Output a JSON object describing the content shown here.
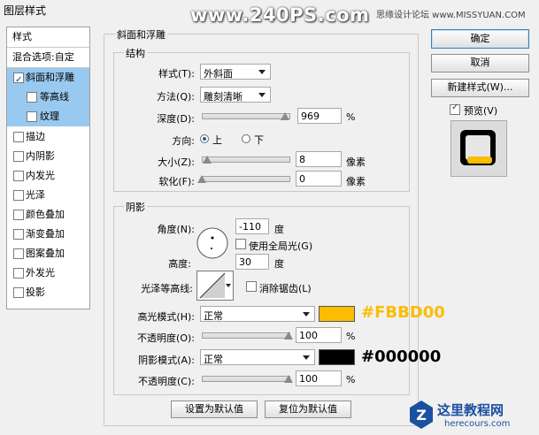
{
  "window": {
    "title": "图层样式"
  },
  "watermark": {
    "site": "www.240PS.com",
    "forum": "思缘设计论坛 www.MISSYUAN.COM",
    "logo": "这里教程网",
    "logo_url": "herecours.com"
  },
  "styles_panel": {
    "header": "样式",
    "blend": "混合选项:自定",
    "items": [
      {
        "label": "斜面和浮雕",
        "checked": true
      },
      {
        "label": "等高线",
        "checked": false
      },
      {
        "label": "纹理",
        "checked": false
      },
      {
        "label": "描边",
        "checked": false
      },
      {
        "label": "内阴影",
        "checked": false
      },
      {
        "label": "内发光",
        "checked": false
      },
      {
        "label": "光泽",
        "checked": false
      },
      {
        "label": "颜色叠加",
        "checked": false
      },
      {
        "label": "渐变叠加",
        "checked": false
      },
      {
        "label": "图案叠加",
        "checked": false
      },
      {
        "label": "外发光",
        "checked": false
      },
      {
        "label": "投影",
        "checked": false
      }
    ]
  },
  "bevel": {
    "title": "斜面和浮雕",
    "structure": {
      "title": "结构",
      "style_label": "样式(T):",
      "style_value": "外斜面",
      "technique_label": "方法(Q):",
      "technique_value": "雕刻清晰",
      "depth_label": "深度(D):",
      "depth_value": "969",
      "depth_unit": "%",
      "direction_label": "方向:",
      "dir_up": "上",
      "dir_down": "下",
      "size_label": "大小(Z):",
      "size_value": "8",
      "size_unit": "像素",
      "soften_label": "软化(F):",
      "soften_value": "0",
      "soften_unit": "像素"
    },
    "shading": {
      "title": "阴影",
      "angle_label": "角度(N):",
      "angle_value": "-110",
      "angle_unit": "度",
      "global_light": "使用全局光(G)",
      "altitude_label": "高度:",
      "altitude_value": "30",
      "altitude_unit": "度",
      "gloss_label": "光泽等高线:",
      "anti_alias": "消除锯齿(L)",
      "highlight_mode_label": "高光模式(H):",
      "highlight_mode": "正常",
      "highlight_color": "#FBBD00",
      "highlight_color_text": "#FBBD00",
      "hl_opacity_label": "不透明度(O):",
      "hl_opacity_value": "100",
      "hl_opacity_unit": "%",
      "shadow_mode_label": "阴影模式(A):",
      "shadow_mode": "正常",
      "shadow_color": "#000000",
      "shadow_color_text": "#000000",
      "sh_opacity_label": "不透明度(C):",
      "sh_opacity_value": "100",
      "sh_opacity_unit": "%"
    },
    "make_default": "设置为默认值",
    "reset_default": "复位为默认值"
  },
  "right": {
    "ok": "确定",
    "cancel": "取消",
    "new_style": "新建样式(W)...",
    "preview": "预览(V)"
  },
  "slider_levels": {
    "depth": 0.97,
    "size": 0.03,
    "soften": 0.0,
    "hl_opacity": 1.0,
    "sh_opacity": 1.0
  },
  "colors": {
    "callout_highlight": "#FBBD00",
    "callout_shadow": "#000000",
    "selection": "#99c9ef"
  }
}
